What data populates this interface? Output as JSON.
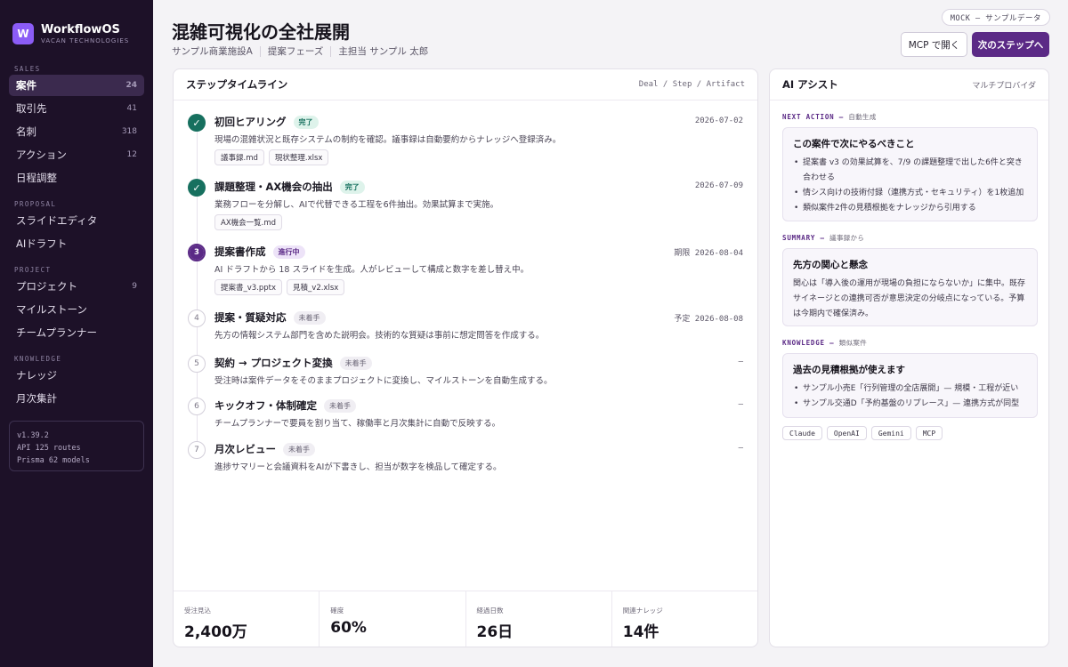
{
  "brand": {
    "logo_letter": "W",
    "name": "WorkflowOS",
    "sub": "VACAN TECHNOLOGIES"
  },
  "sidebar": {
    "sections": [
      {
        "label": "SALES",
        "items": [
          {
            "label": "案件",
            "count": "24",
            "active": true
          },
          {
            "label": "取引先",
            "count": "41"
          },
          {
            "label": "名刺",
            "count": "318"
          },
          {
            "label": "アクション",
            "count": "12"
          },
          {
            "label": "日程調整",
            "count": ""
          }
        ]
      },
      {
        "label": "PROPOSAL",
        "items": [
          {
            "label": "スライドエディタ",
            "count": ""
          },
          {
            "label": "AIドラフト",
            "count": ""
          }
        ]
      },
      {
        "label": "PROJECT",
        "items": [
          {
            "label": "プロジェクト",
            "count": "9"
          },
          {
            "label": "マイルストーン",
            "count": ""
          },
          {
            "label": "チームプランナー",
            "count": ""
          }
        ]
      },
      {
        "label": "KNOWLEDGE",
        "items": [
          {
            "label": "ナレッジ",
            "count": ""
          },
          {
            "label": "月次集計",
            "count": ""
          }
        ]
      }
    ],
    "version": {
      "line1": "v1.39.2",
      "line2": "API 125 routes",
      "line3": "Prisma 62 models"
    }
  },
  "header": {
    "title": "混雑可視化の全社展開",
    "meta": [
      "サンプル商業施設A",
      "提案フェーズ",
      "主担当 サンプル 太郎"
    ],
    "mock_badge": "MOCK — サンプルデータ",
    "mcp_button": "MCP で開く",
    "next_button": "次のステップへ"
  },
  "timeline": {
    "title": "ステップタイムライン",
    "subtitle": "Deal / Step / Artifact",
    "steps": [
      {
        "marker": "✓",
        "title": "初回ヒアリング",
        "badge": "完了",
        "date": "2026-07-02",
        "desc": "現場の混雑状況と既存システムの制約を確認。議事録は自動要約からナレッジへ登録済み。",
        "files": [
          "議事録.md",
          "現状整理.xlsx"
        ]
      },
      {
        "marker": "✓",
        "title": "課題整理・AX機会の抽出",
        "badge": "完了",
        "date": "2026-07-09",
        "desc": "業務フローを分解し、AIで代替できる工程を6件抽出。効果試算まで実施。",
        "files": [
          "AX機会一覧.md"
        ]
      },
      {
        "marker": "3",
        "title": "提案書作成",
        "badge": "進行中",
        "date": "期限 2026-08-04",
        "desc": "AI ドラフトから 18 スライドを生成。人がレビューして構成と数字を差し替え中。",
        "files": [
          "提案書_v3.pptx",
          "見積_v2.xlsx"
        ]
      },
      {
        "marker": "4",
        "title": "提案・質疑対応",
        "badge": "未着手",
        "date": "予定 2026-08-08",
        "desc": "先方の情報システム部門を含めた説明会。技術的な質疑は事前に想定問答を作成する。",
        "files": []
      },
      {
        "marker": "5",
        "title": "契約 → プロジェクト変換",
        "badge": "未着手",
        "date": "—",
        "desc": "受注時は案件データをそのままプロジェクトに変換し、マイルストーンを自動生成する。",
        "files": []
      },
      {
        "marker": "6",
        "title": "キックオフ・体制確定",
        "badge": "未着手",
        "date": "—",
        "desc": "チームプランナーで要員を割り当て、稼働率と月次集計に自動で反映する。",
        "files": []
      },
      {
        "marker": "7",
        "title": "月次レビュー",
        "badge": "未着手",
        "date": "—",
        "desc": "進捗サマリーと会議資料をAIが下書きし、担当が数字を検品して確定する。",
        "files": []
      }
    ]
  },
  "stats": [
    {
      "label": "受注見込",
      "value": "2,400万"
    },
    {
      "label": "確度",
      "value": "60%"
    },
    {
      "label": "経過日数",
      "value": "26日"
    },
    {
      "label": "関連ナレッジ",
      "value": "14件"
    }
  ],
  "ai": {
    "title": "AI アシスト",
    "subtitle": "マルチプロバイダ",
    "next_action": {
      "label": "NEXT ACTION — ",
      "label_sub": "自動生成",
      "title": "この案件で次にやるべきこと",
      "items": [
        "提案書 v3 の効果試算を、7/9 の課題整理で出した6件と突き合わせる",
        "情シス向けの技術付録（連携方式・セキュリティ）を1枚追加",
        "類似案件2件の見積根拠をナレッジから引用する"
      ]
    },
    "summary": {
      "label": "SUMMARY — ",
      "label_sub": "議事録から",
      "title": "先方の関心と懸念",
      "text": "関心は「導入後の運用が現場の負担にならないか」に集中。既存サイネージとの連携可否が意思決定の分岐点になっている。予算は今期内で確保済み。"
    },
    "knowledge": {
      "label": "KNOWLEDGE — ",
      "label_sub": "類似案件",
      "title": "過去の見積根拠が使えます",
      "items": [
        "サンプル小売E「行列管理の全店展開」— 規模・工程が近い",
        "サンプル交通D「予約基盤のリプレース」— 連携方式が同型"
      ]
    },
    "providers": [
      "Claude",
      "OpenAI",
      "Gemini",
      "MCP"
    ]
  }
}
